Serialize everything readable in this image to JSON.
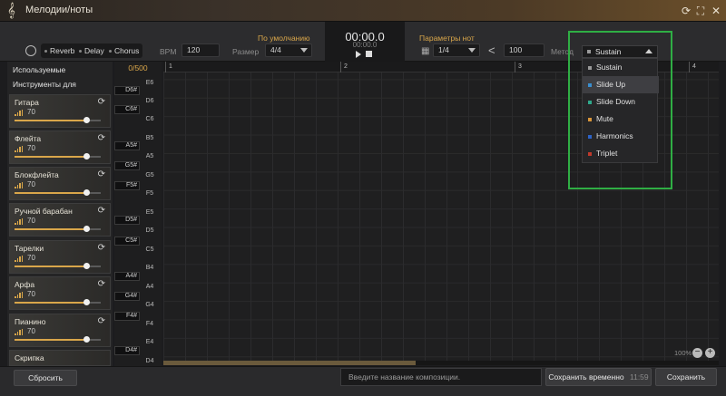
{
  "window": {
    "title": "Мелодии/ноты"
  },
  "toolbar": {
    "effects": [
      "Reverb",
      "Delay",
      "Chorus"
    ],
    "bpm_label": "BPM",
    "bpm_value": "120",
    "default_label": "По умолчанию",
    "size_label": "Размер",
    "size_value": "4/4",
    "time_main": "00:00.0",
    "time_sub": "00:00.0",
    "note_params_label": "Параметры нот",
    "note_value": "1/4",
    "velocity_value": "100",
    "method_label": "Метод",
    "method_value": "Sustain"
  },
  "method_menu": {
    "items": [
      {
        "label": "Sustain",
        "color": "#9a9a9a"
      },
      {
        "label": "Slide Up",
        "color": "#3a8fd0"
      },
      {
        "label": "Slide Down",
        "color": "#2fa98c"
      },
      {
        "label": "Mute",
        "color": "#d9953a"
      },
      {
        "label": "Harmonics",
        "color": "#2d63c8"
      },
      {
        "label": "Triplet",
        "color": "#c0392b"
      }
    ],
    "active_index": 1
  },
  "left_panel": {
    "header1": "Используемые",
    "header2": "Инструменты для",
    "instruments": [
      {
        "name": "Гитара",
        "volume": "70"
      },
      {
        "name": "Флейта",
        "volume": "70"
      },
      {
        "name": "Блокфлейта",
        "volume": "70"
      },
      {
        "name": "Ручной барабан",
        "volume": "70"
      },
      {
        "name": "Тарелки",
        "volume": "70"
      },
      {
        "name": "Арфа",
        "volume": "70"
      },
      {
        "name": "Пианино",
        "volume": "70"
      },
      {
        "name": "Скрипка",
        "volume": ""
      }
    ]
  },
  "piano": {
    "counter": "0/500",
    "white_keys": [
      "E6",
      "D6",
      "C6",
      "B5",
      "A5",
      "G5",
      "F5",
      "E5",
      "D5",
      "C5",
      "B4",
      "A4",
      "G4",
      "F4",
      "E4",
      "D4"
    ],
    "black_keys": [
      "D6#",
      "C6#",
      "A5#",
      "G5#",
      "F5#",
      "D5#",
      "C5#",
      "A4#",
      "G4#",
      "F4#",
      "D4#"
    ]
  },
  "ruler": {
    "measures": [
      "1",
      "2",
      "3",
      "4"
    ]
  },
  "zoom": {
    "value": "100%",
    "minus": "−",
    "plus": "+"
  },
  "bottom": {
    "reset_label": "Сбросить",
    "name_placeholder": "Введите название композиции.",
    "save_temp_label": "Сохранить временно",
    "save_temp_time": "11:59",
    "save_label": "Сохранить"
  },
  "colors": {
    "accent": "#d9a64a",
    "highlight": "#2fae44"
  }
}
